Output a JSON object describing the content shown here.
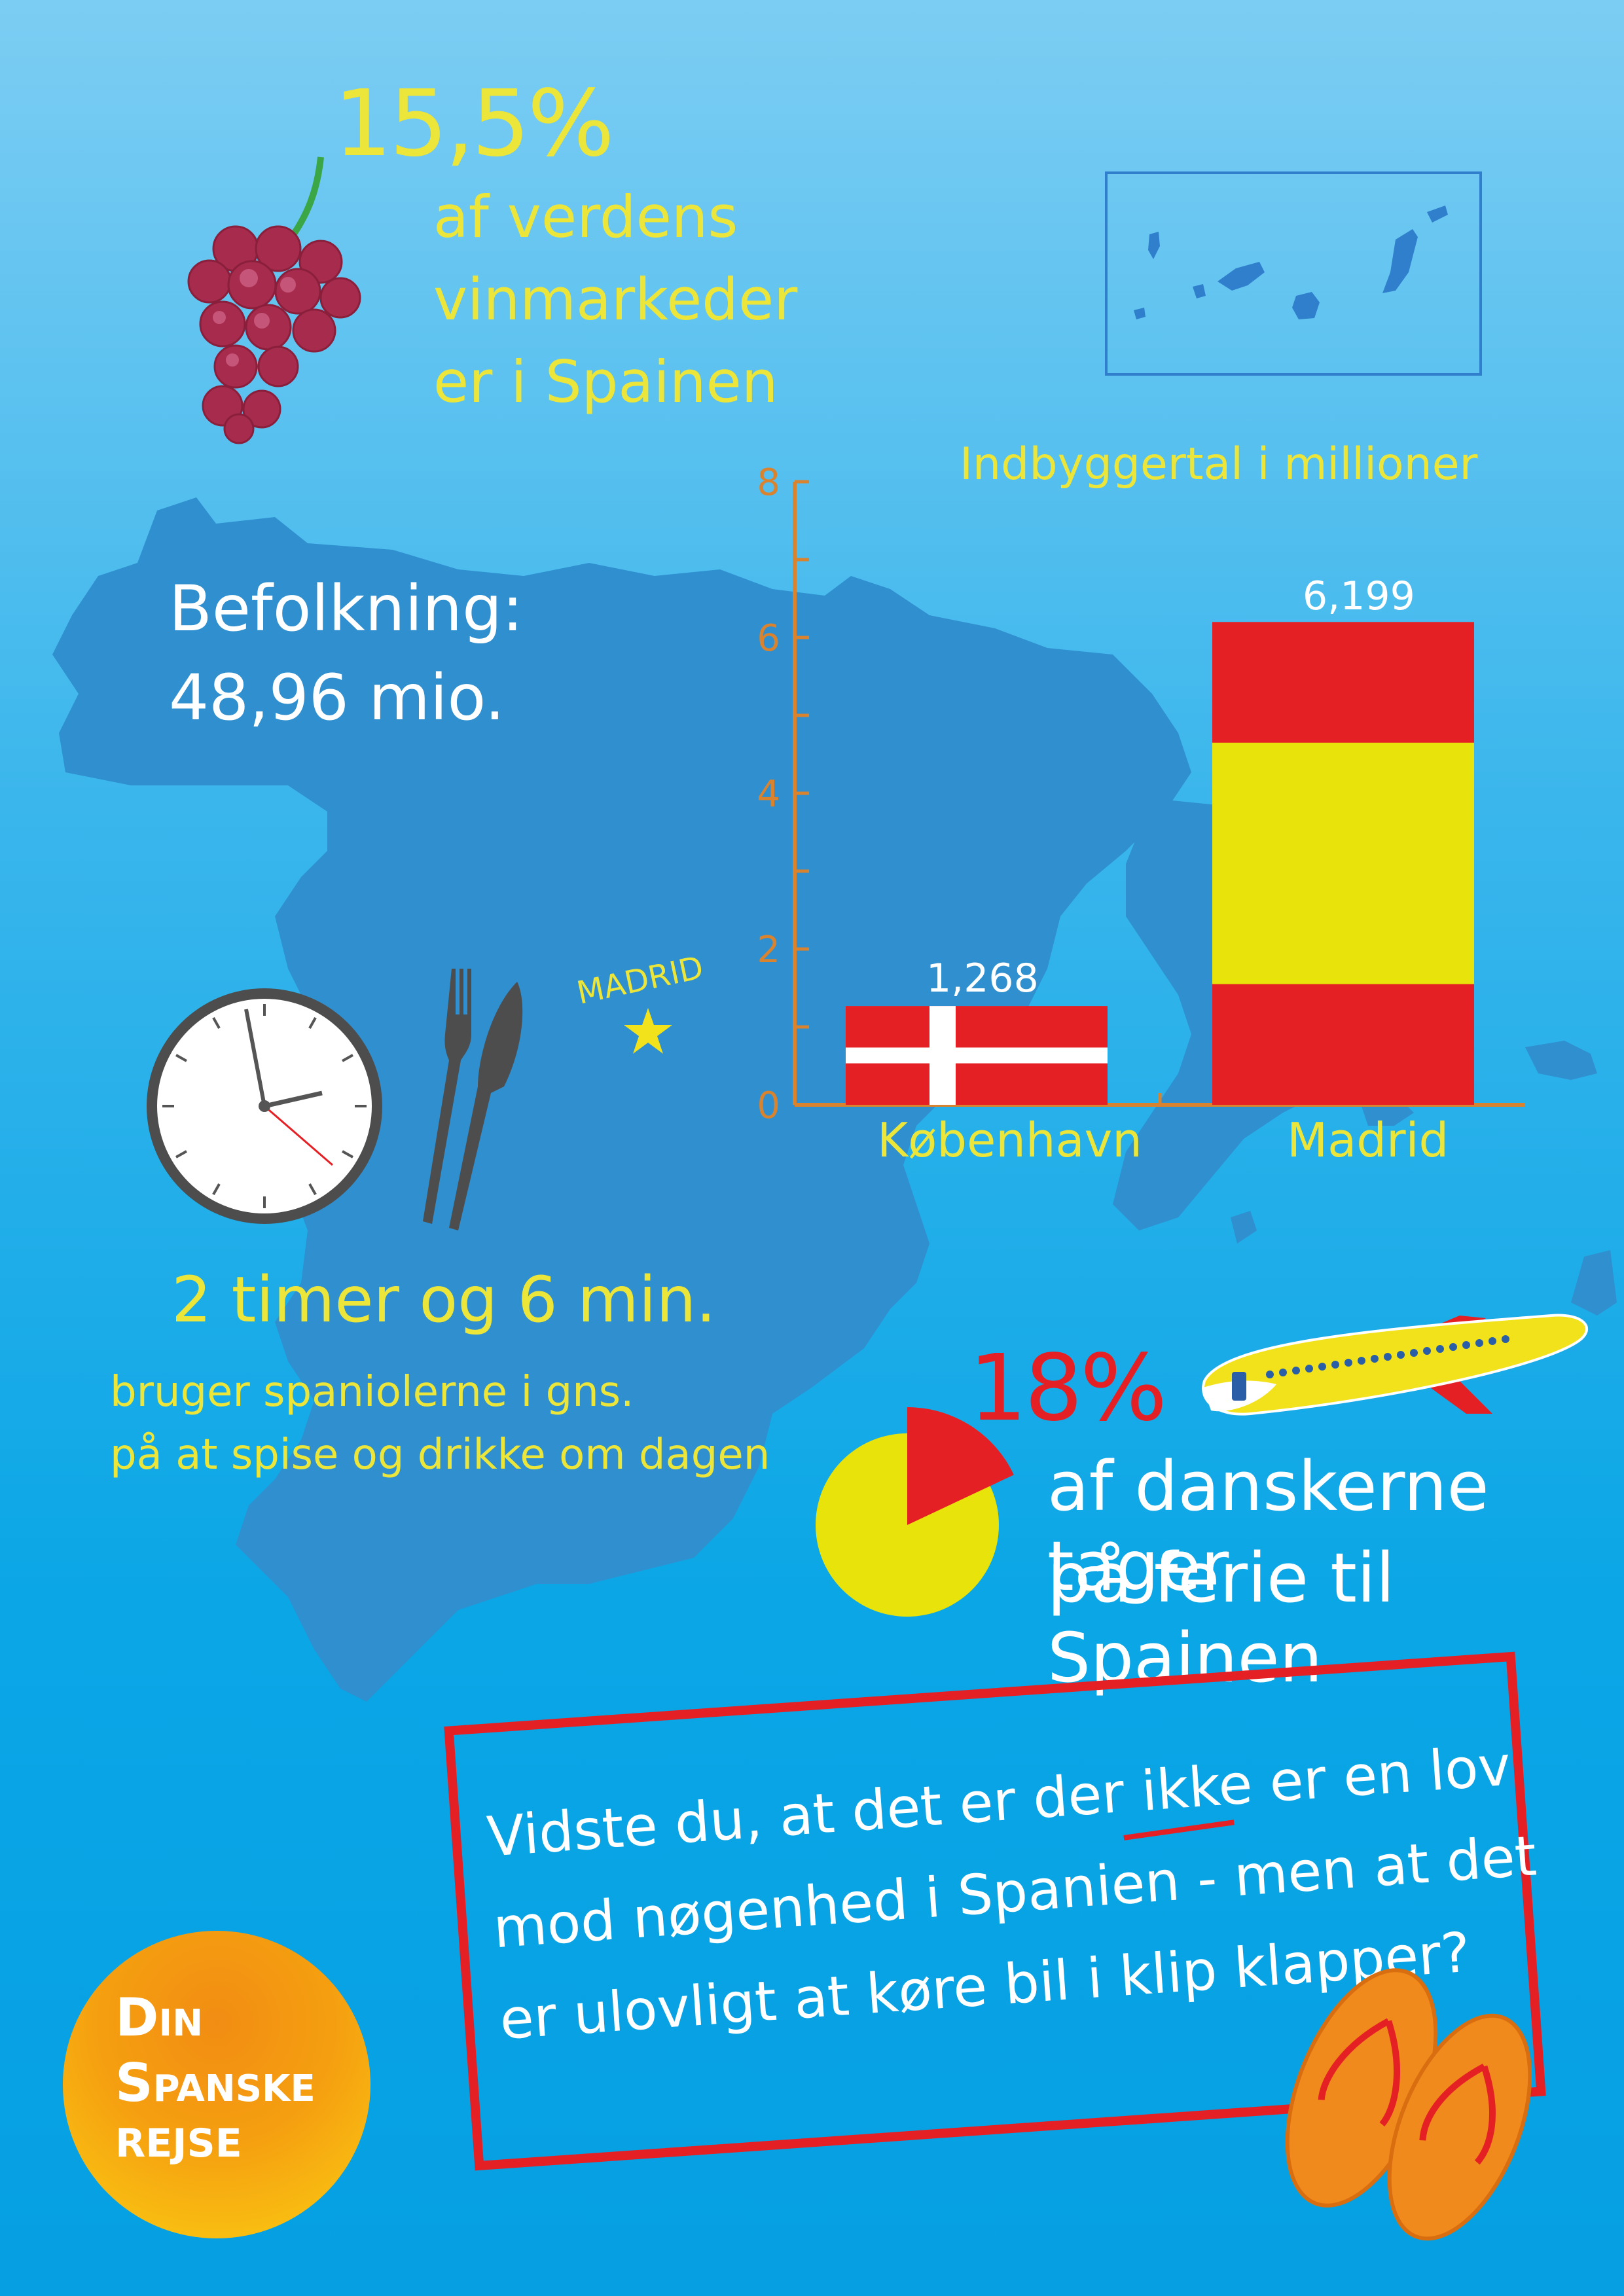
{
  "wine": {
    "stat": "15,5%",
    "text_lines": [
      "af verdens",
      "vinmarkeder",
      "er i Spainen"
    ]
  },
  "population": {
    "label": "Befolkning:",
    "value": "48,96 mio."
  },
  "map": {
    "capital_label": "MADRID"
  },
  "dining": {
    "headline": "2 timer og 6 min.",
    "text_lines": [
      "bruger spaniolerne i gns.",
      "på at spise og drikke om dagen"
    ]
  },
  "travel": {
    "stat": "18%",
    "percent_value": 18,
    "text_lines": [
      "af danskerne tager",
      "på ferie til Spainen"
    ]
  },
  "fact_box": {
    "lines": [
      "Vidste du, at det er der ikke er en lov",
      "mod nøgenhed i Spanien - men at det",
      "er ulovligt at køre bil i klip klapper?"
    ],
    "emphasis": "ikke"
  },
  "logo": {
    "lines": [
      "Din",
      "Spanske",
      "rejse"
    ]
  },
  "colors": {
    "yellow_text": "#ece53a",
    "spain_red": "#e52024",
    "spain_yellow": "#e8e30a",
    "map_blue": "#2f8fcf",
    "axis_orange": "#d9832f",
    "grape": "#a72b4c"
  },
  "chart_data": {
    "type": "bar",
    "title": "Indbyggertal i millioner",
    "categories": [
      "København",
      "Madrid"
    ],
    "values": [
      1.268,
      6.199
    ],
    "value_labels": [
      "1,268",
      "6,199"
    ],
    "ylim": [
      0,
      8
    ],
    "y_ticks": [
      0,
      2,
      4,
      6,
      8
    ],
    "grid": false
  },
  "icons": [
    "grape-icon",
    "clock-icon",
    "fork-knife-icon",
    "airplane-icon",
    "flip-flops-icon",
    "star-icon",
    "pie-chart-icon",
    "canary-islands-map"
  ]
}
